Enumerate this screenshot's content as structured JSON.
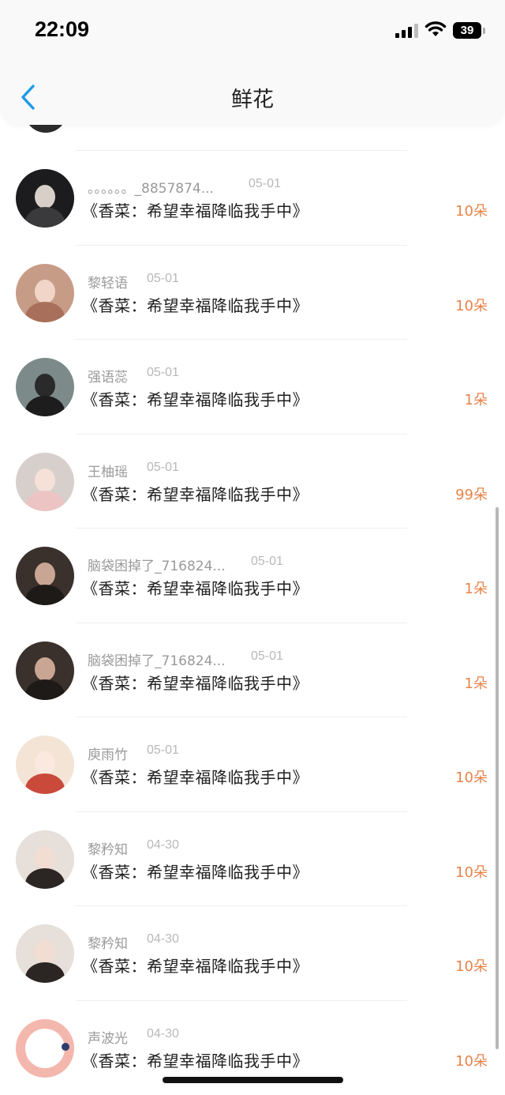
{
  "status_bar": {
    "time": "22:09",
    "battery_percent": "39"
  },
  "header": {
    "title": "鲜花",
    "back_icon": "chevron-left-icon",
    "accent_color": "#1a9be8"
  },
  "count_color": "#e8834a",
  "records": [
    {
      "user": "。。。。。。_8857874...",
      "date": "05-01",
      "work": "《香菜：希望幸福降临我手中》",
      "count": "10朵"
    },
    {
      "user": "黎轻语",
      "date": "05-01",
      "work": "《香菜：希望幸福降临我手中》",
      "count": "10朵"
    },
    {
      "user": "强语蕊",
      "date": "05-01",
      "work": "《香菜：希望幸福降临我手中》",
      "count": "1朵"
    },
    {
      "user": "王柚瑶",
      "date": "05-01",
      "work": "《香菜：希望幸福降临我手中》",
      "count": "99朵"
    },
    {
      "user": "脑袋困掉了_716824...",
      "date": "05-01",
      "work": "《香菜：希望幸福降临我手中》",
      "count": "1朵"
    },
    {
      "user": "脑袋困掉了_716824...",
      "date": "05-01",
      "work": "《香菜：希望幸福降临我手中》",
      "count": "1朵"
    },
    {
      "user": "庾雨竹",
      "date": "05-01",
      "work": "《香菜：希望幸福降临我手中》",
      "count": "10朵"
    },
    {
      "user": "黎矜知",
      "date": "04-30",
      "work": "《香菜：希望幸福降临我手中》",
      "count": "10朵"
    },
    {
      "user": "黎矜知",
      "date": "04-30",
      "work": "《香菜：希望幸福降临我手中》",
      "count": "10朵"
    },
    {
      "user": "声波光",
      "date": "04-30",
      "work": "《香菜：希望幸福降临我手中》",
      "count": "10朵"
    }
  ]
}
